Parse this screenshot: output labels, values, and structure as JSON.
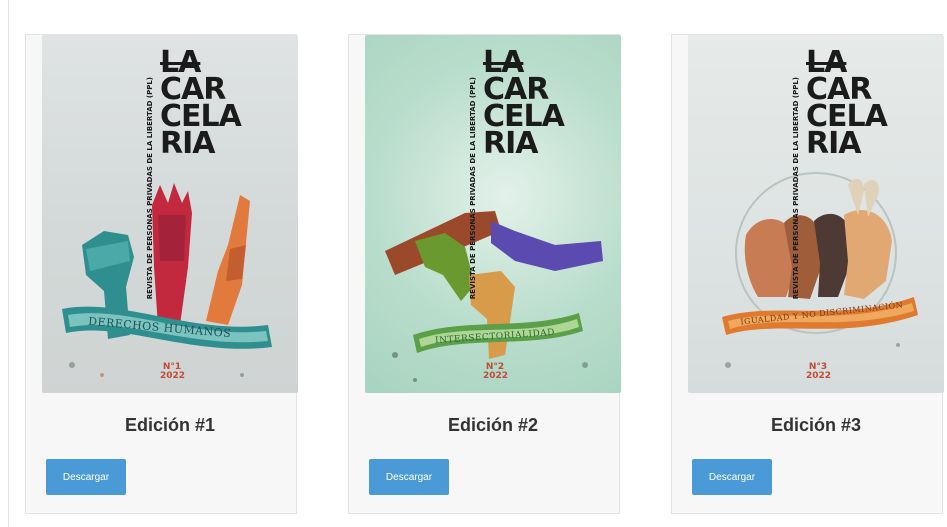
{
  "colors": {
    "button": "#4a9ad8",
    "card_bg": "#f7f7f7",
    "issue_mark": "#c24a36"
  },
  "editions": [
    {
      "masthead": [
        "LA",
        "CAR",
        "CELA",
        "RIA"
      ],
      "cover_subtitle": "REVISTA DE PERSONAS PRIVADAS DE LA LIBERTAD (PPL)",
      "ribbon": "DERECHOS HUMANOS",
      "issue_number": "N°1",
      "issue_year": "2022",
      "title": "Edición #1",
      "button": "Descargar"
    },
    {
      "masthead": [
        "LA",
        "CAR",
        "CELA",
        "RIA"
      ],
      "cover_subtitle": "REVISTA DE PERSONAS PRIVADAS DE LA LIBERTAD (PPL)",
      "ribbon": "INTERSECTORIALIDAD",
      "issue_number": "N°2",
      "issue_year": "2022",
      "title": "Edición #2",
      "button": "Descargar"
    },
    {
      "masthead": [
        "LA",
        "CAR",
        "CELA",
        "RIA"
      ],
      "cover_subtitle": "REVISTA DE PERSONAS PRIVADAS DE LA LIBERTAD (PPL)",
      "ribbon": "IGUALDAD Y NO DISCRIMINACIÓN",
      "issue_number": "N°3",
      "issue_year": "2022",
      "title": "Edición #3",
      "button": "Descargar"
    }
  ]
}
